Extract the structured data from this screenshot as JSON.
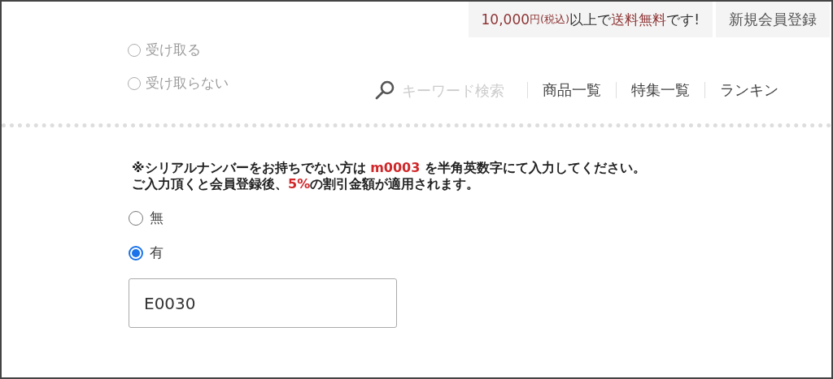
{
  "promo": {
    "segments": [
      {
        "text": "10,000",
        "highlight": true,
        "small": false
      },
      {
        "text": "円(税込)",
        "highlight": true,
        "small": true
      },
      {
        "text": "以上で",
        "highlight": false,
        "small": false
      },
      {
        "text": "送料無料",
        "highlight": true,
        "small": false
      },
      {
        "text": "です!",
        "highlight": false,
        "small": false
      }
    ]
  },
  "register_button": "新規会員登録",
  "ghost_options": [
    {
      "label": "受け取る",
      "selected": false
    },
    {
      "label": "受け取らない",
      "selected": false
    }
  ],
  "search": {
    "placeholder": "キーワード検索"
  },
  "nav": [
    "商品一覧",
    "特集一覧",
    "ランキン"
  ],
  "notice": [
    [
      {
        "text": "※シリアルナンバーをお持ちでない方は ",
        "highlight": false
      },
      {
        "text": "m0003",
        "highlight": true
      },
      {
        "text": " を半角英数字にて入力してください。",
        "highlight": false
      }
    ],
    [
      {
        "text": "ご入力頂くと会員登録後、",
        "highlight": false
      },
      {
        "text": "5%",
        "highlight": true
      },
      {
        "text": "の割引金額が適用されます。",
        "highlight": false
      }
    ]
  ],
  "options": [
    {
      "label": "無",
      "selected": false
    },
    {
      "label": "有",
      "selected": true
    }
  ],
  "serial": {
    "value": "E0030"
  }
}
